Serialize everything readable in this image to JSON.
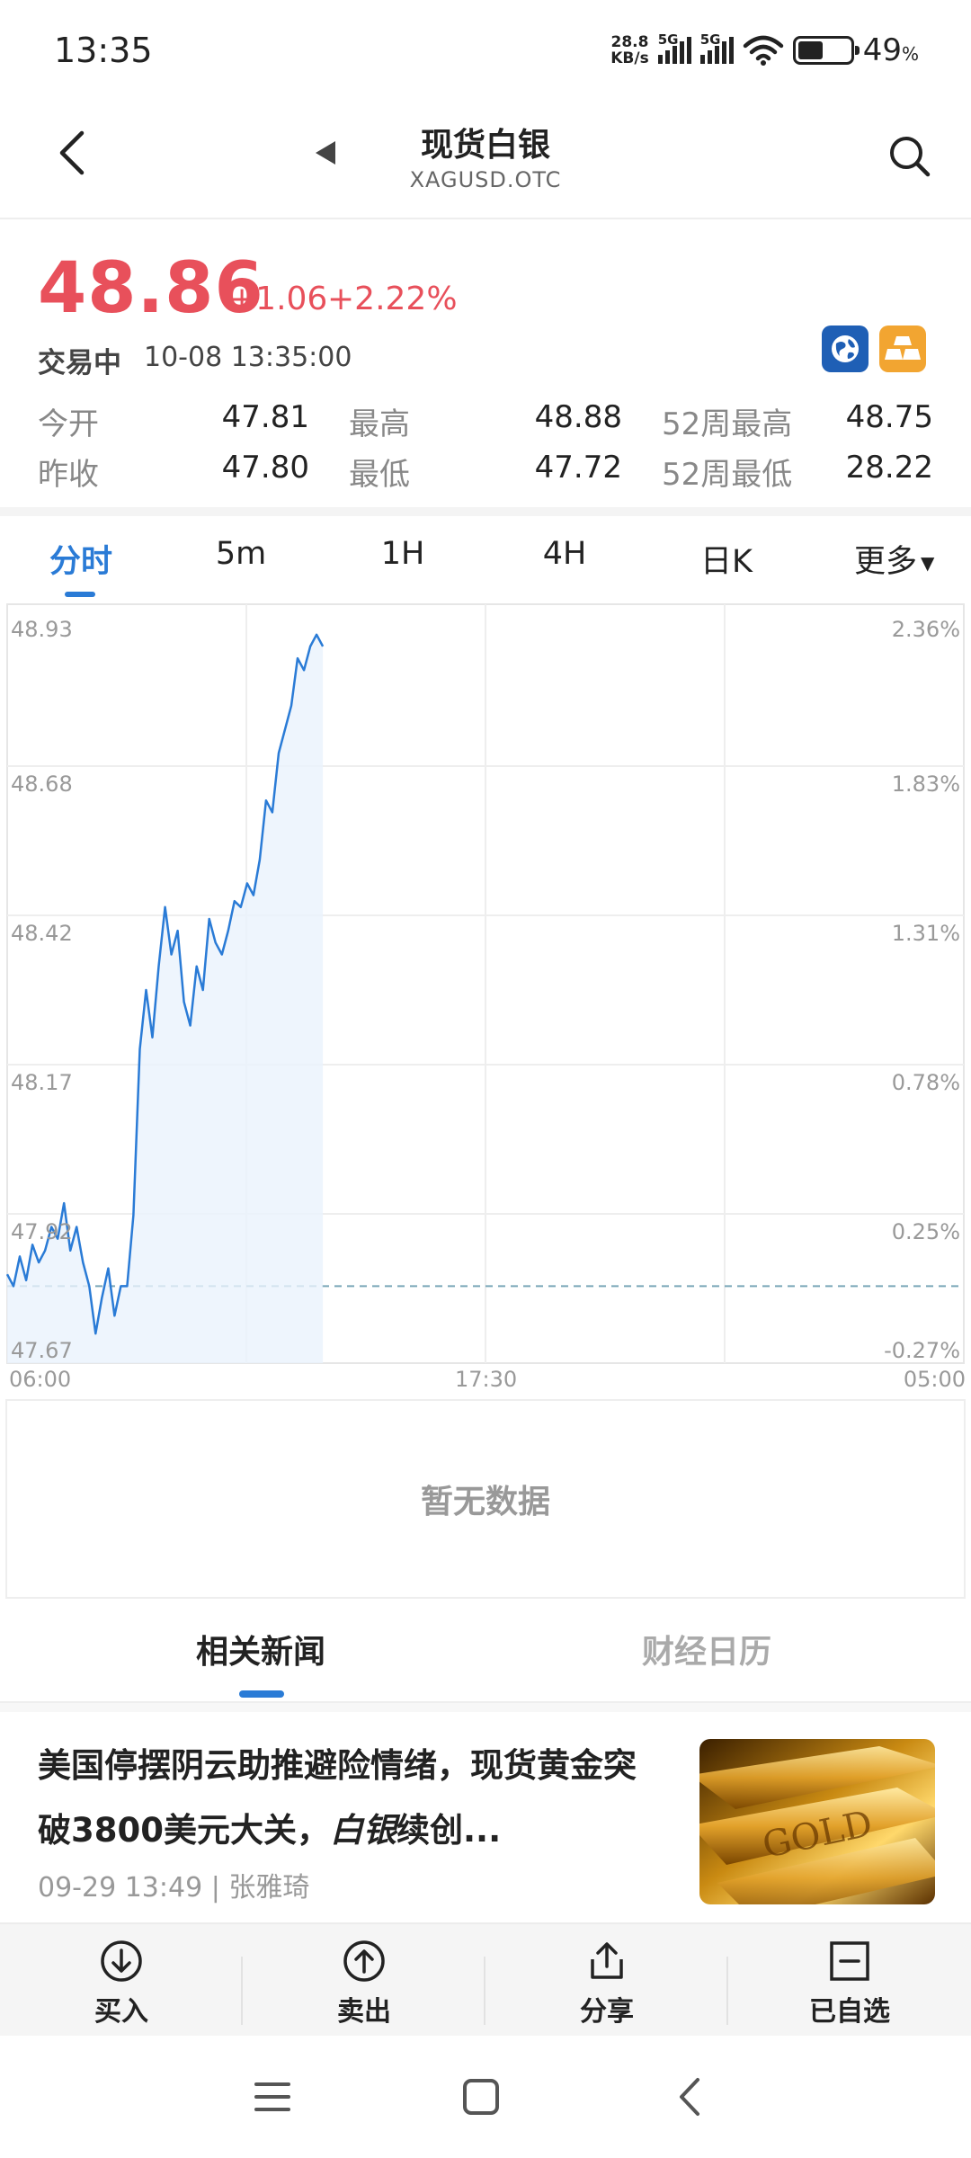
{
  "status_bar": {
    "time": "13:35",
    "net_speed_value": "28.8",
    "net_speed_unit": "KB/s",
    "sim1_label": "5G",
    "sim2_label": "5G",
    "battery_percent_number": "49",
    "battery_percent_sign": "%",
    "battery_level": 0.49
  },
  "header": {
    "title": "现货白银",
    "subtitle": "XAGUSD.OTC"
  },
  "quote": {
    "price": "48.86",
    "change": "+1.06",
    "change_pct": "+2.22%",
    "trade_status": "交易中",
    "timestamp": "10-08 13:35:00",
    "accent_color": "#e8505b",
    "stats": [
      {
        "label": "今开",
        "value": "47.81"
      },
      {
        "label": "最高",
        "value": "48.88"
      },
      {
        "label": "52周最高",
        "value": "48.75"
      },
      {
        "label": "昨收",
        "value": "47.80"
      },
      {
        "label": "最低",
        "value": "47.72"
      },
      {
        "label": "52周最低",
        "value": "28.22"
      }
    ]
  },
  "period_tabs": {
    "items": [
      "分时",
      "5m",
      "1H",
      "4H",
      "日K"
    ],
    "active": "分时",
    "more_label": "更多"
  },
  "chart_data": {
    "type": "line",
    "y_left_ticks": [
      "48.93",
      "48.68",
      "48.42",
      "48.17",
      "47.92",
      "47.67"
    ],
    "y_right_ticks": [
      "2.36%",
      "1.83%",
      "1.31%",
      "0.78%",
      "0.25%",
      "-0.27%"
    ],
    "x_ticks": [
      "06:00",
      "17:30",
      "05:00"
    ],
    "ylim": [
      47.67,
      48.93
    ],
    "prev_close": 47.8,
    "line_color": "#2a7bd6",
    "x_progress": [
      0,
      0.02,
      0.04,
      0.06,
      0.08,
      0.1,
      0.12,
      0.14,
      0.16,
      0.18,
      0.2,
      0.22,
      0.24,
      0.26,
      0.28,
      0.3,
      0.32,
      0.34,
      0.36,
      0.38,
      0.4,
      0.42,
      0.44,
      0.46,
      0.48,
      0.5,
      0.52,
      0.54,
      0.56,
      0.58,
      0.6,
      0.62,
      0.64,
      0.66,
      0.68,
      0.7,
      0.72,
      0.74,
      0.76,
      0.78,
      0.8,
      0.82,
      0.84,
      0.86,
      0.88,
      0.9,
      0.92,
      0.94,
      0.96,
      0.98,
      1.0
    ],
    "values": [
      47.82,
      47.8,
      47.85,
      47.81,
      47.87,
      47.84,
      47.86,
      47.9,
      47.88,
      47.94,
      47.86,
      47.9,
      47.84,
      47.8,
      47.72,
      47.78,
      47.83,
      47.75,
      47.8,
      47.8,
      47.92,
      48.2,
      48.3,
      48.22,
      48.34,
      48.44,
      48.36,
      48.4,
      48.28,
      48.24,
      48.34,
      48.3,
      48.42,
      48.38,
      48.36,
      48.4,
      48.45,
      48.44,
      48.48,
      48.46,
      48.52,
      48.62,
      48.6,
      48.7,
      48.74,
      48.78,
      48.86,
      48.84,
      48.88,
      48.9,
      48.88
    ],
    "session_progress_end": 0.33
  },
  "no_data_text": "暂无数据",
  "news_tabs": {
    "items": [
      "相关新闻",
      "财经日历"
    ],
    "active": "相关新闻"
  },
  "news": [
    {
      "title_part1": "美国停摆阴云助推避险情绪，现货黄金突破3800美元大关，",
      "title_highlight": "白银",
      "title_part2": "续创...",
      "time": "09-29 13:49",
      "author": "张雅琦",
      "thumb_icon": "gold-bars-photo"
    }
  ],
  "actions": [
    {
      "label": "买入",
      "icon": "arrow-down-circle-icon"
    },
    {
      "label": "卖出",
      "icon": "arrow-up-circle-icon"
    },
    {
      "label": "分享",
      "icon": "share-icon"
    },
    {
      "label": "已自选",
      "icon": "minus-square-icon"
    }
  ]
}
